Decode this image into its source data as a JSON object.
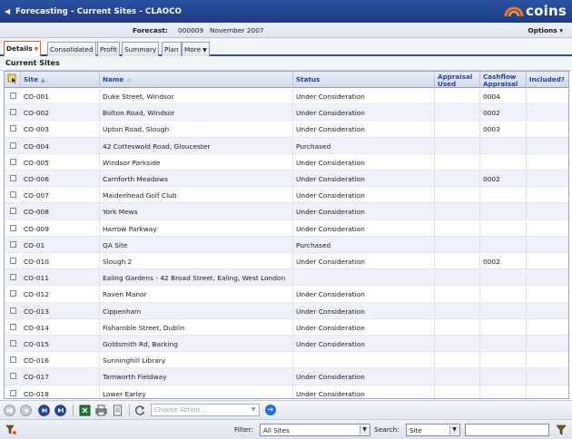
{
  "titlebar": {
    "title": "Forecasting - Current Sites - CLAOCO",
    "logo_text": "coins",
    "brand_color": "#e8761e"
  },
  "infobar": {
    "forecast_label": "Forecast:",
    "forecast_number": "000009",
    "forecast_period": "November 2007",
    "options_label": "Options"
  },
  "tabs": [
    {
      "label": "Details",
      "has_caret": true,
      "active": true
    },
    {
      "label": "Consolidated"
    },
    {
      "label": "Profit"
    },
    {
      "label": "Summary"
    },
    {
      "label": "Plan"
    },
    {
      "label": "More",
      "has_caret": true
    }
  ],
  "section_title": "Current Sites",
  "table": {
    "columns": {
      "site": "Site",
      "name": "Name",
      "status": "Status",
      "appraisal_used": "Appraisal Used",
      "cashflow_appraisal": "Cashflow Appraisal",
      "included": "Included?"
    },
    "rows": [
      {
        "site": "CO-001",
        "name": "Duke Street, Windsor",
        "status": "Under Consideration",
        "cashflow": "0004"
      },
      {
        "site": "CO-002",
        "name": "Bolton Road, Windsor",
        "status": "Under Consideration",
        "cashflow": "0002"
      },
      {
        "site": "CO-003",
        "name": "Upton Road, Slough",
        "status": "Under Consideration",
        "cashflow": "0003"
      },
      {
        "site": "CO-004",
        "name": "42 Cotteswold Road, Gloucester",
        "status": "Purchased",
        "cashflow": ""
      },
      {
        "site": "CO-005",
        "name": "Windsor Parkside",
        "status": "Under Consideration",
        "cashflow": ""
      },
      {
        "site": "CO-006",
        "name": "Carnforth Meadows",
        "status": "Under Consideration",
        "cashflow": "0002"
      },
      {
        "site": "CO-007",
        "name": "Maidenhead Golf Club",
        "status": "Under Consideration",
        "cashflow": ""
      },
      {
        "site": "CO-008",
        "name": "York Mews",
        "status": "Under Consideration",
        "cashflow": ""
      },
      {
        "site": "CO-009",
        "name": "Harrow Parkway",
        "status": "Under Consideration",
        "cashflow": ""
      },
      {
        "site": "CO-01",
        "name": "QA Site",
        "status": "Purchased",
        "cashflow": ""
      },
      {
        "site": "CO-010",
        "name": "Slough 2",
        "status": "Under Consideration",
        "cashflow": "0002"
      },
      {
        "site": "CO-011",
        "name": "Ealing Gardens - 42 Broad Street, Ealing, West London",
        "status": "",
        "cashflow": ""
      },
      {
        "site": "CO-012",
        "name": "Raven Manor",
        "status": "Under Consideration",
        "cashflow": ""
      },
      {
        "site": "CO-013",
        "name": "Cippenham",
        "status": "Under Consideration",
        "cashflow": ""
      },
      {
        "site": "CO-014",
        "name": "Fishamble Street, Dublin",
        "status": "Under Consideration",
        "cashflow": ""
      },
      {
        "site": "CO-015",
        "name": "Goldsmith Rd, Barking",
        "status": "Under Consideration",
        "cashflow": ""
      },
      {
        "site": "CO-016",
        "name": "Sunninghill Library",
        "status": "",
        "cashflow": ""
      },
      {
        "site": "CO-017",
        "name": "Tamworth Fieldway",
        "status": "Under Consideration",
        "cashflow": ""
      },
      {
        "site": "CO-018",
        "name": "Lower Earley",
        "status": "Under Consideration",
        "cashflow": ""
      }
    ]
  },
  "toolbar": {
    "action_placeholder": "Choose Action ..."
  },
  "filterbar": {
    "filter_label": "Filter:",
    "filter_value": "All Sites",
    "search_label": "Search:",
    "search_field": "Site",
    "search_text": ""
  }
}
